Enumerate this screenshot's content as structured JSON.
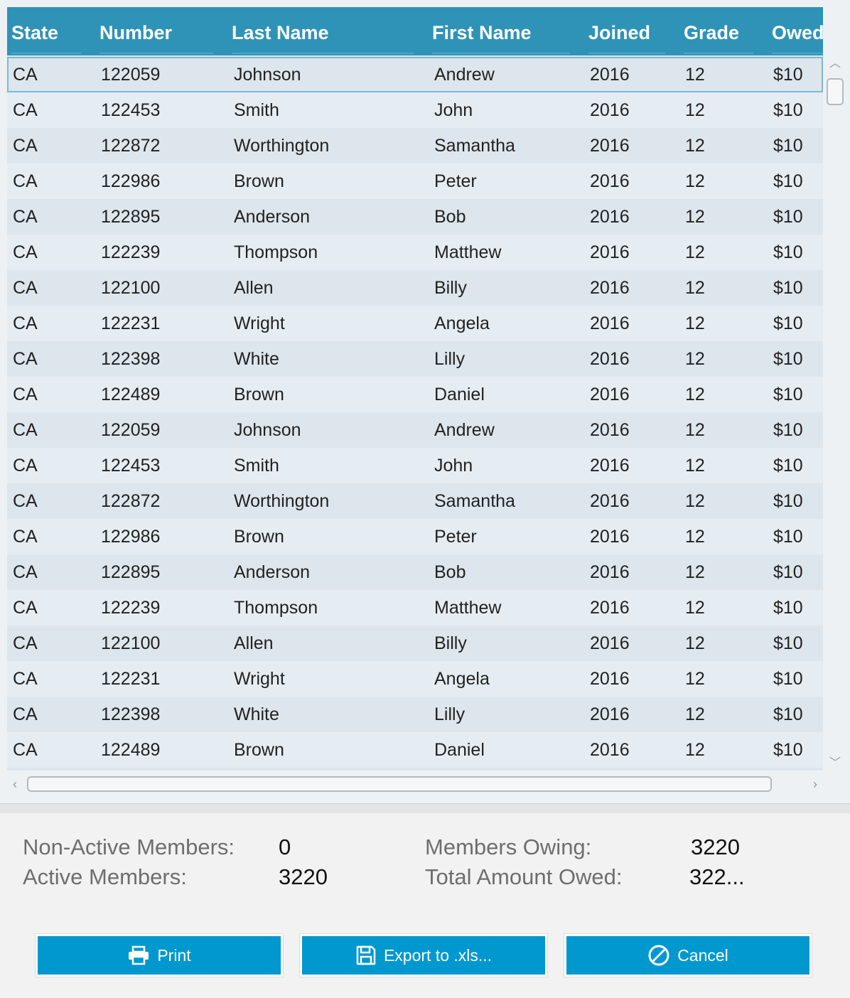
{
  "table": {
    "columns": [
      "State",
      "Number",
      "Last Name",
      "First Name",
      "Joined",
      "Grade",
      "Owed"
    ],
    "rows": [
      [
        "CA",
        "122059",
        "Johnson",
        "Andrew",
        "2016",
        "12",
        "$10"
      ],
      [
        "CA",
        "122453",
        "Smith",
        "John",
        "2016",
        "12",
        "$10"
      ],
      [
        "CA",
        "122872",
        "Worthington",
        "Samantha",
        "2016",
        "12",
        "$10"
      ],
      [
        "CA",
        "122986",
        "Brown",
        "Peter",
        "2016",
        "12",
        "$10"
      ],
      [
        "CA",
        "122895",
        "Anderson",
        "Bob",
        "2016",
        "12",
        "$10"
      ],
      [
        "CA",
        "122239",
        "Thompson",
        "Matthew",
        "2016",
        "12",
        "$10"
      ],
      [
        "CA",
        "122100",
        "Allen",
        "Billy",
        "2016",
        "12",
        "$10"
      ],
      [
        "CA",
        "122231",
        "Wright",
        "Angela",
        "2016",
        "12",
        "$10"
      ],
      [
        "CA",
        "122398",
        "White",
        "Lilly",
        "2016",
        "12",
        "$10"
      ],
      [
        "CA",
        "122489",
        "Brown",
        "Daniel",
        "2016",
        "12",
        "$10"
      ],
      [
        "CA",
        "122059",
        "Johnson",
        "Andrew",
        "2016",
        "12",
        "$10"
      ],
      [
        "CA",
        "122453",
        "Smith",
        "John",
        "2016",
        "12",
        "$10"
      ],
      [
        "CA",
        "122872",
        "Worthington",
        "Samantha",
        "2016",
        "12",
        "$10"
      ],
      [
        "CA",
        "122986",
        "Brown",
        "Peter",
        "2016",
        "12",
        "$10"
      ],
      [
        "CA",
        "122895",
        "Anderson",
        "Bob",
        "2016",
        "12",
        "$10"
      ],
      [
        "CA",
        "122239",
        "Thompson",
        "Matthew",
        "2016",
        "12",
        "$10"
      ],
      [
        "CA",
        "122100",
        "Allen",
        "Billy",
        "2016",
        "12",
        "$10"
      ],
      [
        "CA",
        "122231",
        "Wright",
        "Angela",
        "2016",
        "12",
        "$10"
      ],
      [
        "CA",
        "122398",
        "White",
        "Lilly",
        "2016",
        "12",
        "$10"
      ],
      [
        "CA",
        "122489",
        "Brown",
        "Daniel",
        "2016",
        "12",
        "$10"
      ]
    ]
  },
  "summary": {
    "non_active_label": "Non-Active Members:",
    "non_active_value": "0",
    "active_label": "Active Members:",
    "active_value": "3220",
    "owing_label": "Members Owing:",
    "owing_value": "3220",
    "total_owed_label": "Total Amount Owed:",
    "total_owed_value": "322..."
  },
  "buttons": {
    "print": "Print",
    "export": "Export to .xls...",
    "cancel": "Cancel"
  },
  "colors": {
    "header": "#2f93b7",
    "button": "#0098cf"
  }
}
